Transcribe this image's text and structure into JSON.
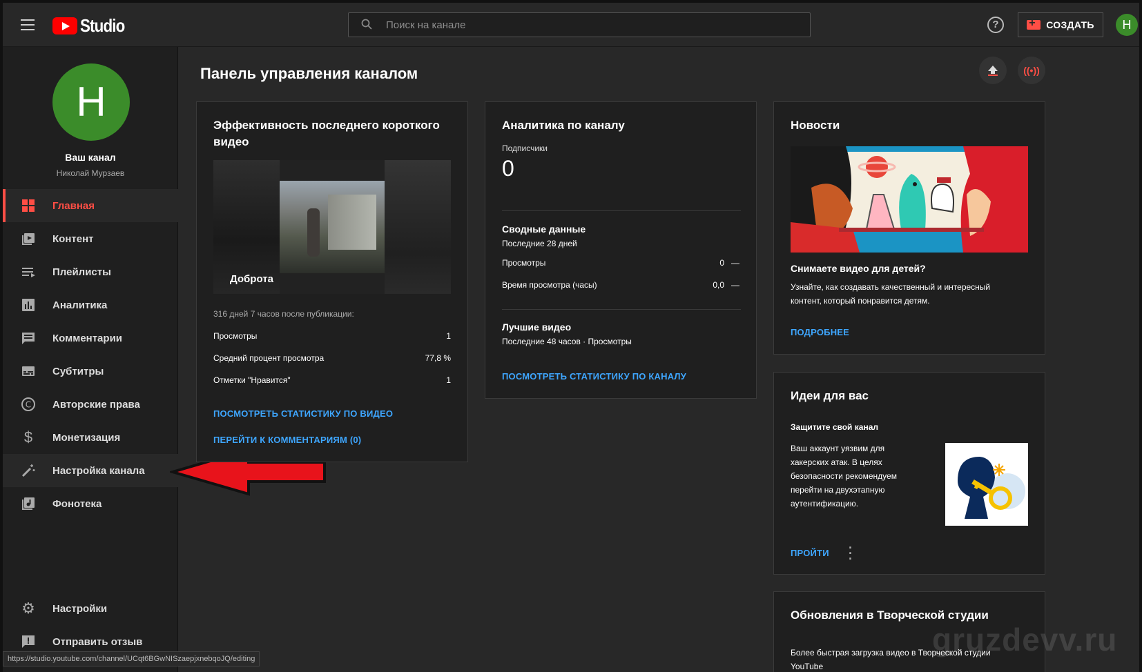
{
  "header": {
    "logo_text": "Studio",
    "search_placeholder": "Поиск на канале",
    "create_label": "СОЗДАТЬ",
    "avatar_letter": "Н"
  },
  "sidebar": {
    "avatar_letter": "Н",
    "channel_name": "Ваш канал",
    "channel_user": "Николай Мурзаев",
    "items": [
      {
        "label": "Главная",
        "icon": "dashboard-icon",
        "active": true
      },
      {
        "label": "Контент",
        "icon": "content-icon"
      },
      {
        "label": "Плейлисты",
        "icon": "playlists-icon"
      },
      {
        "label": "Аналитика",
        "icon": "analytics-icon"
      },
      {
        "label": "Комментарии",
        "icon": "comments-icon"
      },
      {
        "label": "Субтитры",
        "icon": "subtitles-icon"
      },
      {
        "label": "Авторские права",
        "icon": "copyright-icon"
      },
      {
        "label": "Монетизация",
        "icon": "dollar-icon"
      },
      {
        "label": "Настройка канала",
        "icon": "magic-wand-icon"
      },
      {
        "label": "Фонотека",
        "icon": "audio-library-icon"
      }
    ],
    "bottom_items": [
      {
        "label": "Настройки",
        "icon": "gear-icon"
      },
      {
        "label": "Отправить отзыв",
        "icon": "feedback-icon"
      }
    ]
  },
  "main": {
    "title": "Панель управления каналом"
  },
  "video_card": {
    "title": "Эффективность последнего короткого видео",
    "thumb_label": "Доброта",
    "since": "316 дней 7 часов после публикации:",
    "rows": [
      {
        "label": "Просмотры",
        "value": "1"
      },
      {
        "label": "Средний процент просмотра",
        "value": "77,8 %"
      },
      {
        "label": "Отметки \"Нравится\"",
        "value": "1"
      }
    ],
    "link_stats": "ПОСМОТРЕТЬ СТАТИСТИКУ ПО ВИДЕО",
    "link_comments": "ПЕРЕЙТИ К КОММЕНТАРИЯМ (0)"
  },
  "analytics_card": {
    "title": "Аналитика по каналу",
    "subs_label": "Подписчики",
    "subs_value": "0",
    "summary_title": "Сводные данные",
    "summary_period": "Последние 28 дней",
    "rows": [
      {
        "label": "Просмотры",
        "value": "0",
        "trend": "—"
      },
      {
        "label": "Время просмотра (часы)",
        "value": "0,0",
        "trend": "—"
      }
    ],
    "top_title": "Лучшие видео",
    "top_period": "Последние 48 часов · Просмотры",
    "link": "ПОСМОТРЕТЬ СТАТИСТИКУ ПО КАНАЛУ"
  },
  "news_card": {
    "title": "Новости",
    "headline": "Снимаете видео для детей?",
    "body": "Узнайте, как создавать качественный и интересный контент, который понравится детям.",
    "link": "ПОДРОБНЕЕ"
  },
  "ideas_card": {
    "title": "Идеи для вас",
    "subtitle": "Защитите свой канал",
    "body": "Ваш аккаунт уязвим для хакерских атак. В целях безопасности рекомендуем перейти на двухэтапную аутентификацию.",
    "link": "ПРОЙТИ"
  },
  "updates_card": {
    "title": "Обновления в Творческой студии",
    "body": "Более быстрая загрузка видео в Творческой студии YouTube"
  },
  "status_bar": {
    "url": "https://studio.youtube.com/channel/UCqt6BGwNISzaepjxnebqoJQ/editing"
  },
  "watermark": "gruzdevv.ru",
  "colors": {
    "accent": "#ff4e45",
    "link": "#3ea6ff",
    "avatar": "#3b8c2a"
  }
}
